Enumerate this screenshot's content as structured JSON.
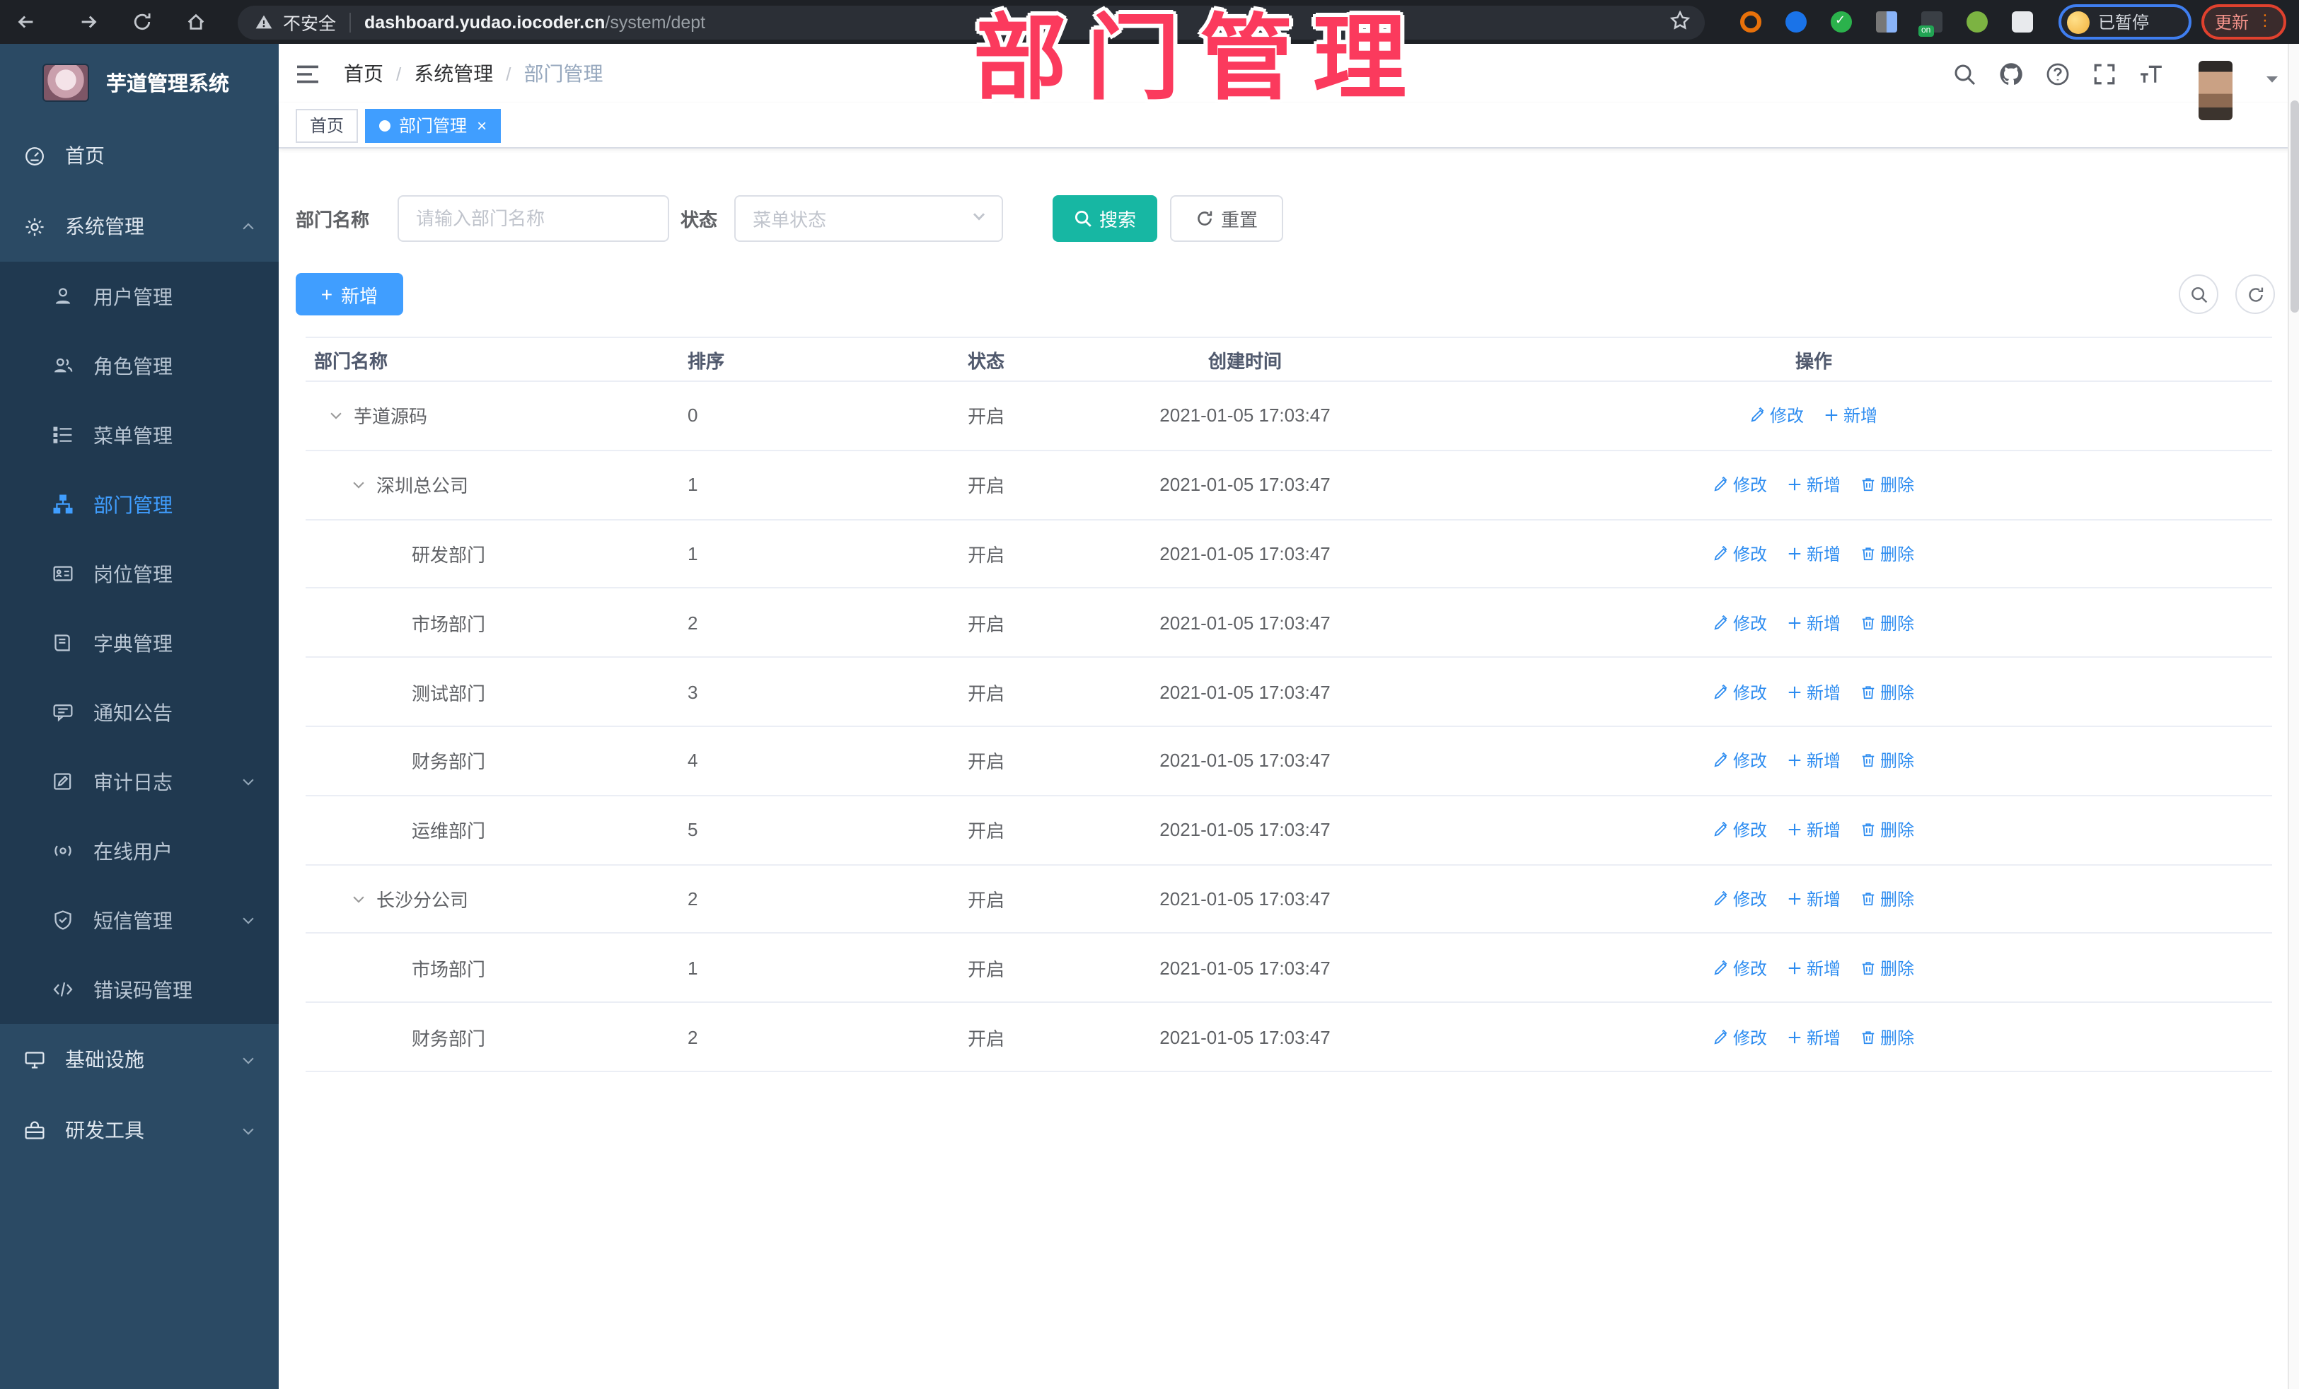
{
  "annotation": {
    "text": "部门管理",
    "color": "#fb3a5d"
  },
  "browser": {
    "security_label": "不安全",
    "url_host": "dashboard.yudao.iocoder.cn",
    "url_path": "/system/dept",
    "profile_label": "已暂停",
    "update_label": "更新",
    "extensions": [
      {
        "name": "ext-orange-ring-icon",
        "color": "#e8710a",
        "style": "ring"
      },
      {
        "name": "ext-blue-pin-icon",
        "color": "#1a73e8",
        "style": "solid"
      },
      {
        "name": "ext-green-check-icon",
        "color": "#2bb24c",
        "style": "check"
      },
      {
        "name": "ext-grid-icon",
        "color": "#8ab4f8",
        "style": "grid"
      },
      {
        "name": "ext-on-badge-icon",
        "color": "#21a453",
        "style": "badge",
        "badge_text": "on"
      },
      {
        "name": "ext-green-leaf-icon",
        "color": "#7cb342",
        "style": "solid"
      },
      {
        "name": "ext-puzzle-icon",
        "color": "#e8eaed",
        "style": "puzzle"
      }
    ]
  },
  "sidebar": {
    "title": "芋道管理系统",
    "items": [
      {
        "label": "首页",
        "icon": "dashboard-icon",
        "level": "root"
      },
      {
        "label": "系统管理",
        "icon": "gear-icon",
        "level": "root",
        "chevron": "up"
      },
      {
        "label": "用户管理",
        "icon": "user-icon",
        "level": "sub"
      },
      {
        "label": "角色管理",
        "icon": "users-icon",
        "level": "sub"
      },
      {
        "label": "菜单管理",
        "icon": "menu-list-icon",
        "level": "sub"
      },
      {
        "label": "部门管理",
        "icon": "org-tree-icon",
        "level": "sub",
        "active": true
      },
      {
        "label": "岗位管理",
        "icon": "id-card-icon",
        "level": "sub"
      },
      {
        "label": "字典管理",
        "icon": "book-icon",
        "level": "sub"
      },
      {
        "label": "通知公告",
        "icon": "megaphone-icon",
        "level": "sub"
      },
      {
        "label": "审计日志",
        "icon": "edit-log-icon",
        "level": "sub",
        "chevron": "down"
      },
      {
        "label": "在线用户",
        "icon": "online-user-icon",
        "level": "sub"
      },
      {
        "label": "短信管理",
        "icon": "sms-icon",
        "level": "sub",
        "chevron": "down"
      },
      {
        "label": "错误码管理",
        "icon": "code-icon",
        "level": "sub"
      },
      {
        "label": "基础设施",
        "icon": "infra-icon",
        "level": "root",
        "chevron": "down"
      },
      {
        "label": "研发工具",
        "icon": "tools-icon",
        "level": "root",
        "chevron": "down"
      }
    ]
  },
  "header": {
    "breadcrumb": [
      "首页",
      "系统管理",
      "部门管理"
    ]
  },
  "tabs": [
    {
      "label": "首页",
      "active": false
    },
    {
      "label": "部门管理",
      "active": true,
      "closable": true
    }
  ],
  "filters": {
    "dept_label": "部门名称",
    "dept_placeholder": "请输入部门名称",
    "status_label": "状态",
    "status_placeholder": "菜单状态",
    "search_label": "搜索",
    "reset_label": "重置"
  },
  "toolbar": {
    "add_label": "新增"
  },
  "table": {
    "columns": [
      "部门名称",
      "排序",
      "状态",
      "创建时间",
      "操作"
    ],
    "action_labels": {
      "edit": "修改",
      "add": "新增",
      "delete": "删除"
    },
    "rows": [
      {
        "name": "芋道源码",
        "level": 0,
        "expandable": true,
        "sort": "0",
        "status": "开启",
        "created": "2021-01-05 17:03:47",
        "actions": [
          "edit",
          "add"
        ]
      },
      {
        "name": "深圳总公司",
        "level": 1,
        "expandable": true,
        "sort": "1",
        "status": "开启",
        "created": "2021-01-05 17:03:47",
        "actions": [
          "edit",
          "add",
          "delete"
        ]
      },
      {
        "name": "研发部门",
        "level": 2,
        "expandable": false,
        "sort": "1",
        "status": "开启",
        "created": "2021-01-05 17:03:47",
        "actions": [
          "edit",
          "add",
          "delete"
        ]
      },
      {
        "name": "市场部门",
        "level": 2,
        "expandable": false,
        "sort": "2",
        "status": "开启",
        "created": "2021-01-05 17:03:47",
        "actions": [
          "edit",
          "add",
          "delete"
        ]
      },
      {
        "name": "测试部门",
        "level": 2,
        "expandable": false,
        "sort": "3",
        "status": "开启",
        "created": "2021-01-05 17:03:47",
        "actions": [
          "edit",
          "add",
          "delete"
        ]
      },
      {
        "name": "财务部门",
        "level": 2,
        "expandable": false,
        "sort": "4",
        "status": "开启",
        "created": "2021-01-05 17:03:47",
        "actions": [
          "edit",
          "add",
          "delete"
        ]
      },
      {
        "name": "运维部门",
        "level": 2,
        "expandable": false,
        "sort": "5",
        "status": "开启",
        "created": "2021-01-05 17:03:47",
        "actions": [
          "edit",
          "add",
          "delete"
        ]
      },
      {
        "name": "长沙分公司",
        "level": 1,
        "expandable": true,
        "sort": "2",
        "status": "开启",
        "created": "2021-01-05 17:03:47",
        "actions": [
          "edit",
          "add",
          "delete"
        ]
      },
      {
        "name": "市场部门",
        "level": 2,
        "expandable": false,
        "sort": "1",
        "status": "开启",
        "created": "2021-01-05 17:03:47",
        "actions": [
          "edit",
          "add",
          "delete"
        ]
      },
      {
        "name": "财务部门",
        "level": 2,
        "expandable": false,
        "sort": "2",
        "status": "开启",
        "created": "2021-01-05 17:03:47",
        "actions": [
          "edit",
          "add",
          "delete"
        ]
      }
    ]
  },
  "colors": {
    "accent_blue": "#409eff",
    "search_teal": "#17b7a3",
    "link_blue": "#2d8cf0",
    "sidebar_bg": "#2b4a64",
    "submenu_bg": "#203950",
    "annotation_pink": "#fb3a5d"
  }
}
